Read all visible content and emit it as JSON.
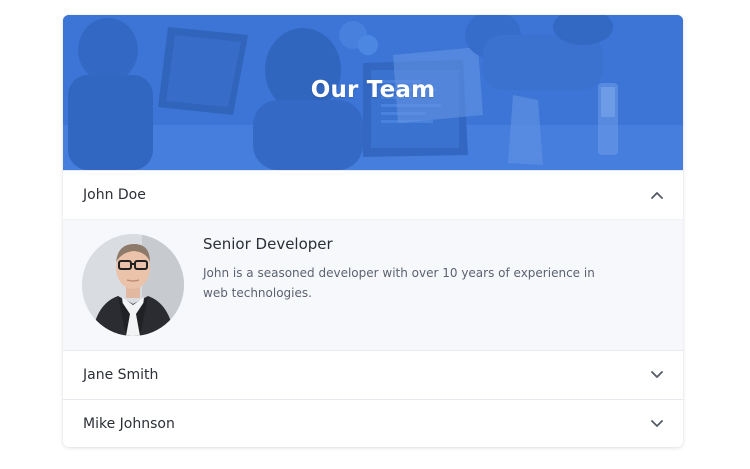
{
  "header": {
    "title": "Our Team"
  },
  "members": [
    {
      "name": "John Doe",
      "expanded": true,
      "toggle_icon": "chevron-up-icon",
      "role": "Senior Developer",
      "bio": "John is a seasoned developer with over 10 years of experience in web technologies."
    },
    {
      "name": "Jane Smith",
      "expanded": false,
      "toggle_icon": "chevron-down-icon"
    },
    {
      "name": "Mike Johnson",
      "expanded": false,
      "toggle_icon": "chevron-down-icon"
    }
  ],
  "colors": {
    "banner_blue": "#3f77d6",
    "body_bg": "#f7f8fb",
    "text_dark": "#2b2f36",
    "text_muted": "#5b6270"
  }
}
